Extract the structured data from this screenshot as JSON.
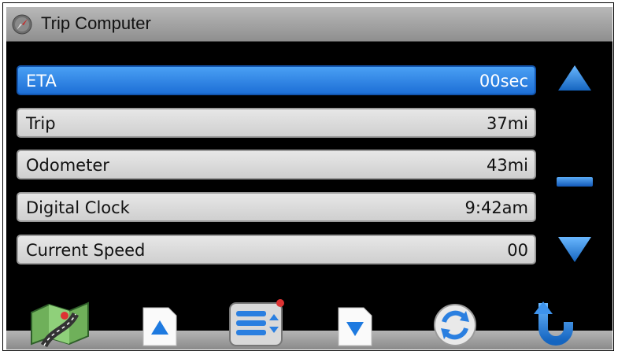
{
  "window": {
    "title": "Trip Computer"
  },
  "rows": [
    {
      "label": "ETA",
      "value": "00sec",
      "selected": true
    },
    {
      "label": "Trip",
      "value": "37mi",
      "selected": false
    },
    {
      "label": "Odometer",
      "value": "43mi",
      "selected": false
    },
    {
      "label": "Digital Clock",
      "value": "9:42am",
      "selected": false
    },
    {
      "label": "Current Speed",
      "value": "00",
      "selected": false
    }
  ],
  "icons": {
    "title": "compass-icon",
    "scroll_up": "up-arrow-icon",
    "scroll_thumb": "scrollbar-thumb",
    "scroll_down": "down-arrow-icon",
    "map": "map-icon",
    "page_up": "page-up-icon",
    "menu": "menu-list-icon",
    "page_down": "page-down-icon",
    "refresh": "refresh-icon",
    "back": "back-arrow-icon"
  },
  "colors": {
    "selected_row": "#1d6fd6",
    "row": "#d9d9d9",
    "accent": "#2a7fe0",
    "background": "#000000"
  }
}
